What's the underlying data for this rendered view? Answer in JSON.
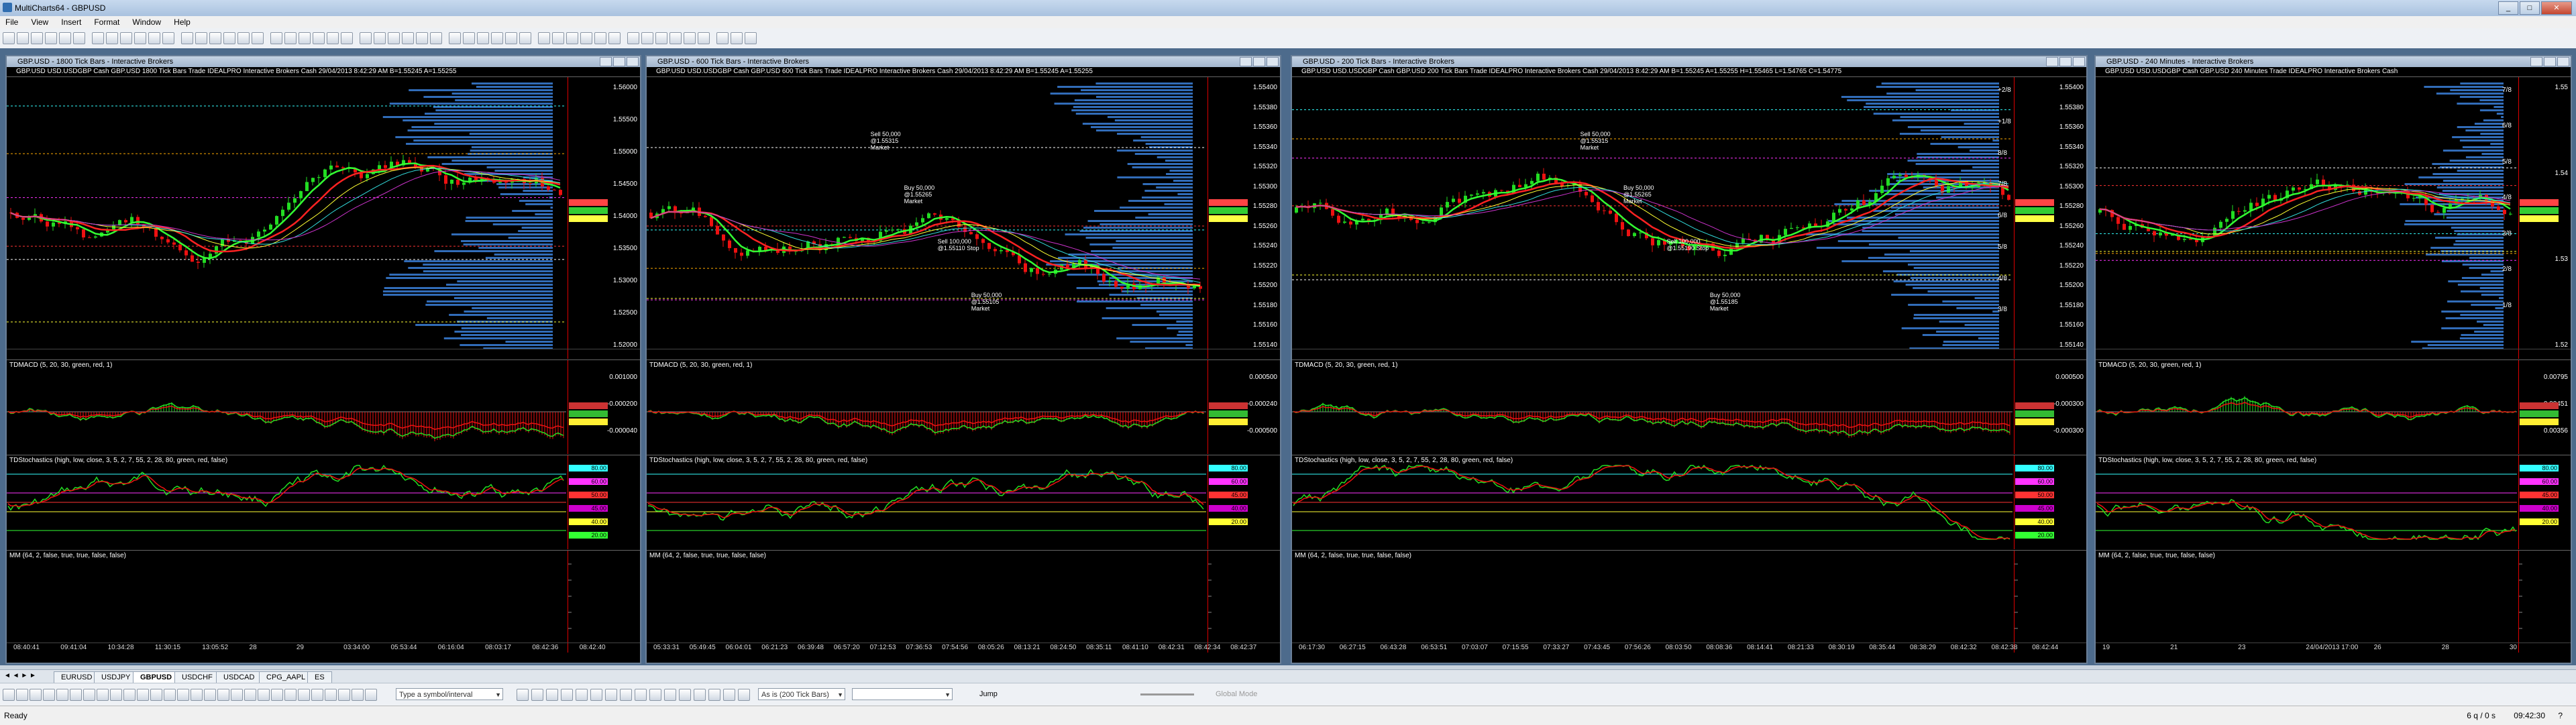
{
  "app": {
    "title": "MultiCharts64 - GBPUSD",
    "menus": [
      "File",
      "View",
      "Insert",
      "Format",
      "Window",
      "Help"
    ]
  },
  "charts": [
    {
      "title": "GBP.USD - 1800 Tick Bars - Interactive Brokers",
      "info": "GBP.USD  USD.USDGBP Cash GBP.USD  1800 Tick Bars   Trade  IDEALPRO  Interactive Brokers  Cash  29/04/2013  8:42:29 AM  B=1.55245  A=1.55255",
      "price_labels": [
        "1.56000",
        "1.55500",
        "1.55000",
        "1.54500",
        "1.54000",
        "1.53500",
        "1.53000",
        "1.52500",
        "1.52000"
      ],
      "time_labels": [
        "08:40:41",
        "09:41:04",
        "10:34:28",
        "11:30:15",
        "13:05:52",
        "28",
        "29",
        "03:34:00",
        "05:53:44",
        "06:16:04",
        "08:03:17",
        "08:42:36",
        "08:42:40"
      ],
      "macd": {
        "label": "TDMACD (5, 20, 30, green, red, 1)",
        "values": [
          "-0.000100",
          "-0.000328",
          "0.00000"
        ],
        "axis": [
          "0.001000",
          "-0.000200",
          "-0.000040"
        ]
      },
      "stoch": {
        "label": "TDStochastics (high, low, close, 3, 5, 2, 7, 55, 2, 28, 80, green, red, false)",
        "values": [
          "20.00",
          "60.00",
          "20.00",
          "45.00"
        ],
        "axis": [
          "80.00",
          "60.00",
          "50.00",
          "45.00",
          "40.00",
          "20.00"
        ]
      },
      "mm": {
        "label": "MM (64, 2, false, true, true, false, false)"
      }
    },
    {
      "title": "GBP.USD - 600 Tick Bars - Interactive Brokers",
      "info": "GBP.USD  USD.USDGBP Cash GBP.USD  600 Tick Bars   Trade  IDEALPRO  Interactive Brokers  Cash  29/04/2013  8:42:29 AM  B=1.55245  A=1.55255",
      "price_labels": [
        "1.55400",
        "1.55380",
        "1.55360",
        "1.55340",
        "1.55320",
        "1.55300",
        "1.55280",
        "1.55260",
        "1.55240",
        "1.55220",
        "1.55200",
        "1.55180",
        "1.55160",
        "1.55140"
      ],
      "annotations": [
        "Sell 50,000 @1.55315 Market",
        "Buy 50,000 @1.55265 Market",
        "Sell 100,000 @1.55110 Stop",
        "Buy 50,000 @1.55105 Market"
      ],
      "time_labels": [
        "05:33:31",
        "05:49:45",
        "06:04:01",
        "06:21:23",
        "06:39:48",
        "06:57:20",
        "07:12:53",
        "07:36:53",
        "07:54:56",
        "08:05:26",
        "08:13:21",
        "08:24:50",
        "08:35:11",
        "08:41:10",
        "08:42:31",
        "08:42:34",
        "08:42:37"
      ],
      "macd": {
        "label": "TDMACD (5, 20, 30, green, red, 1)",
        "values": [
          "-0.00024",
          "0.00000",
          "-0.00024"
        ],
        "axis": [
          "0.000500",
          "-0.000240",
          "-0.000500"
        ]
      },
      "stoch": {
        "label": "TDStochastics (high, low, close, 3, 5, 2, 7, 55, 2, 28, 80, green, red, false)",
        "values": [
          "30.76",
          "80.00",
          "20.00",
          "45.00",
          "40.00"
        ],
        "axis": [
          "80.00",
          "60.00",
          "45.00",
          "40.00",
          "20.00"
        ]
      },
      "mm": {
        "label": "MM (64, 2, false, true, true, false, false)"
      }
    },
    {
      "title": "GBP.USD - 200 Tick Bars - Interactive Brokers",
      "info": "GBP.USD  USD.USDGBP Cash GBP.USD  200 Tick Bars   Trade  IDEALPRO  Interactive Brokers  Cash  29/04/2013  8:42:29 AM  B=1.55245  A=1.55255  H=1.55465  L=1.54765  C=1.54775",
      "price_labels": [
        "1.55400",
        "1.55380",
        "1.55360",
        "1.55340",
        "1.55320",
        "1.55300",
        "1.55280",
        "1.55260",
        "1.55240",
        "1.55220",
        "1.55200",
        "1.55180",
        "1.55160",
        "1.55140"
      ],
      "murrey": [
        "+2/8",
        "+1/8",
        "8/8",
        "7/8",
        "6/8",
        "5/8",
        "4/8",
        "3/8"
      ],
      "annotations": [
        "Sell 50,000 @1.55315 Market",
        "Buy 50,000 @1.55265 Market",
        "Sell 100,000 @1.55190 Stop",
        "Buy 50,000 @1.55185 Market"
      ],
      "time_labels": [
        "06:17:30",
        "06:27:15",
        "06:43:28",
        "06:53:51",
        "07:03:07",
        "07:15:55",
        "07:33:27",
        "07:43:45",
        "07:56:26",
        "08:03:50",
        "08:08:36",
        "08:14:41",
        "08:21:33",
        "08:30:19",
        "08:35:44",
        "08:38:29",
        "08:42:32",
        "08:42:38",
        "08:42:44"
      ],
      "macd": {
        "label": "TDMACD (5, 20, 30, green, red, 1)",
        "values": [
          "-0.00017",
          "0.00000",
          "-0.00029"
        ],
        "axis": [
          "0.000500",
          "-0.000300",
          "-0.000300"
        ]
      },
      "stoch": {
        "label": "TDStochastics (high, low, close, 3, 5, 2, 7, 55, 2, 28, 80, green, red, false)",
        "values": [
          "31.56",
          "80.00",
          "20.00",
          "45.00",
          "40.00"
        ],
        "axis": [
          "80.00",
          "60.00",
          "50.00",
          "45.00",
          "40.00",
          "20.00"
        ]
      },
      "mm": {
        "label": "MM (64, 2, false, true, true, false, false)"
      }
    },
    {
      "title": "GBP.USD - 240 Minutes - Interactive Brokers",
      "info": "GBP.USD  USD.USDGBP Cash GBP.USD  240 Minutes   Trade  IDEALPRO  Interactive Brokers  Cash",
      "price_labels": [
        "1.55",
        "1.54",
        "1.53",
        "1.52"
      ],
      "murrey": [
        "7/8",
        "6/8",
        "5/8",
        "4/8",
        "3/8",
        "2/8",
        "1/8"
      ],
      "time_labels": [
        "19",
        "21",
        "23",
        "24/04/2013 17:00",
        "26",
        "28",
        "30"
      ],
      "macd": {
        "label": "TDMACD (5, 20, 30, green, red, 1)",
        "values": [
          "0.00795",
          "0.00451",
          "0.00356"
        ],
        "axis": [
          "0.00795",
          "0.00451",
          "0.00356"
        ]
      },
      "stoch": {
        "label": "TDStochastics (high, low, close, 3, 5, 2, 7, 55, 2, 28, 80, green, red, false)",
        "values": [
          "20.00",
          "45.00",
          "40.00"
        ],
        "axis": [
          "80.00",
          "60.00",
          "45.00",
          "40.00",
          "20.00"
        ]
      },
      "mm": {
        "label": "MM (64, 2, false, true, true, false, false)"
      }
    }
  ],
  "tabs": [
    "EURUSD",
    "USDJPY",
    "GBPUSD",
    "USDCHF",
    "USDCAD",
    "CPG_AAPL",
    "ES"
  ],
  "active_tab": "GBPUSD",
  "drawbar": {
    "symbol_placeholder": "Type a symbol/interval",
    "interval_combo": "As is (200 Tick Bars)",
    "jump_label": "Jump",
    "global_mode_label": "Global Mode"
  },
  "status": {
    "left": "Ready",
    "right_count": "6 q / 0 s",
    "clock": "09:42:30",
    "help": "?"
  },
  "colors": {
    "bull": "#22dd22",
    "bear": "#ee1111",
    "volume_profile": "#3a7fd8",
    "ma_green": "#33ff33",
    "ma_red": "#ff2222",
    "ma_yellow": "#ffff33",
    "ma_cyan": "#33dddd",
    "ma_magenta": "#cc33cc"
  }
}
